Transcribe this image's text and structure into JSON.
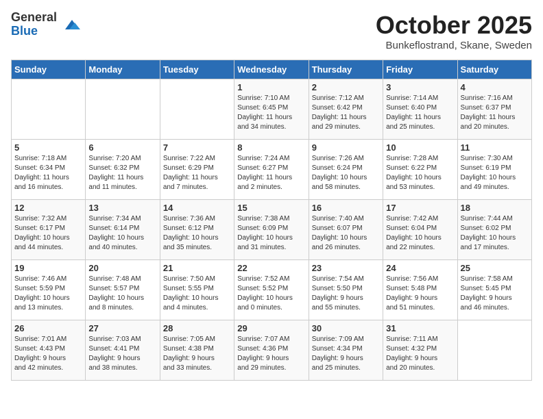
{
  "header": {
    "logo_general": "General",
    "logo_blue": "Blue",
    "month": "October 2025",
    "location": "Bunkeflostrand, Skane, Sweden"
  },
  "days_of_week": [
    "Sunday",
    "Monday",
    "Tuesday",
    "Wednesday",
    "Thursday",
    "Friday",
    "Saturday"
  ],
  "weeks": [
    [
      {
        "day": "",
        "info": ""
      },
      {
        "day": "",
        "info": ""
      },
      {
        "day": "",
        "info": ""
      },
      {
        "day": "1",
        "info": "Sunrise: 7:10 AM\nSunset: 6:45 PM\nDaylight: 11 hours\nand 34 minutes."
      },
      {
        "day": "2",
        "info": "Sunrise: 7:12 AM\nSunset: 6:42 PM\nDaylight: 11 hours\nand 29 minutes."
      },
      {
        "day": "3",
        "info": "Sunrise: 7:14 AM\nSunset: 6:40 PM\nDaylight: 11 hours\nand 25 minutes."
      },
      {
        "day": "4",
        "info": "Sunrise: 7:16 AM\nSunset: 6:37 PM\nDaylight: 11 hours\nand 20 minutes."
      }
    ],
    [
      {
        "day": "5",
        "info": "Sunrise: 7:18 AM\nSunset: 6:34 PM\nDaylight: 11 hours\nand 16 minutes."
      },
      {
        "day": "6",
        "info": "Sunrise: 7:20 AM\nSunset: 6:32 PM\nDaylight: 11 hours\nand 11 minutes."
      },
      {
        "day": "7",
        "info": "Sunrise: 7:22 AM\nSunset: 6:29 PM\nDaylight: 11 hours\nand 7 minutes."
      },
      {
        "day": "8",
        "info": "Sunrise: 7:24 AM\nSunset: 6:27 PM\nDaylight: 11 hours\nand 2 minutes."
      },
      {
        "day": "9",
        "info": "Sunrise: 7:26 AM\nSunset: 6:24 PM\nDaylight: 10 hours\nand 58 minutes."
      },
      {
        "day": "10",
        "info": "Sunrise: 7:28 AM\nSunset: 6:22 PM\nDaylight: 10 hours\nand 53 minutes."
      },
      {
        "day": "11",
        "info": "Sunrise: 7:30 AM\nSunset: 6:19 PM\nDaylight: 10 hours\nand 49 minutes."
      }
    ],
    [
      {
        "day": "12",
        "info": "Sunrise: 7:32 AM\nSunset: 6:17 PM\nDaylight: 10 hours\nand 44 minutes."
      },
      {
        "day": "13",
        "info": "Sunrise: 7:34 AM\nSunset: 6:14 PM\nDaylight: 10 hours\nand 40 minutes."
      },
      {
        "day": "14",
        "info": "Sunrise: 7:36 AM\nSunset: 6:12 PM\nDaylight: 10 hours\nand 35 minutes."
      },
      {
        "day": "15",
        "info": "Sunrise: 7:38 AM\nSunset: 6:09 PM\nDaylight: 10 hours\nand 31 minutes."
      },
      {
        "day": "16",
        "info": "Sunrise: 7:40 AM\nSunset: 6:07 PM\nDaylight: 10 hours\nand 26 minutes."
      },
      {
        "day": "17",
        "info": "Sunrise: 7:42 AM\nSunset: 6:04 PM\nDaylight: 10 hours\nand 22 minutes."
      },
      {
        "day": "18",
        "info": "Sunrise: 7:44 AM\nSunset: 6:02 PM\nDaylight: 10 hours\nand 17 minutes."
      }
    ],
    [
      {
        "day": "19",
        "info": "Sunrise: 7:46 AM\nSunset: 5:59 PM\nDaylight: 10 hours\nand 13 minutes."
      },
      {
        "day": "20",
        "info": "Sunrise: 7:48 AM\nSunset: 5:57 PM\nDaylight: 10 hours\nand 8 minutes."
      },
      {
        "day": "21",
        "info": "Sunrise: 7:50 AM\nSunset: 5:55 PM\nDaylight: 10 hours\nand 4 minutes."
      },
      {
        "day": "22",
        "info": "Sunrise: 7:52 AM\nSunset: 5:52 PM\nDaylight: 10 hours\nand 0 minutes."
      },
      {
        "day": "23",
        "info": "Sunrise: 7:54 AM\nSunset: 5:50 PM\nDaylight: 9 hours\nand 55 minutes."
      },
      {
        "day": "24",
        "info": "Sunrise: 7:56 AM\nSunset: 5:48 PM\nDaylight: 9 hours\nand 51 minutes."
      },
      {
        "day": "25",
        "info": "Sunrise: 7:58 AM\nSunset: 5:45 PM\nDaylight: 9 hours\nand 46 minutes."
      }
    ],
    [
      {
        "day": "26",
        "info": "Sunrise: 7:01 AM\nSunset: 4:43 PM\nDaylight: 9 hours\nand 42 minutes."
      },
      {
        "day": "27",
        "info": "Sunrise: 7:03 AM\nSunset: 4:41 PM\nDaylight: 9 hours\nand 38 minutes."
      },
      {
        "day": "28",
        "info": "Sunrise: 7:05 AM\nSunset: 4:38 PM\nDaylight: 9 hours\nand 33 minutes."
      },
      {
        "day": "29",
        "info": "Sunrise: 7:07 AM\nSunset: 4:36 PM\nDaylight: 9 hours\nand 29 minutes."
      },
      {
        "day": "30",
        "info": "Sunrise: 7:09 AM\nSunset: 4:34 PM\nDaylight: 9 hours\nand 25 minutes."
      },
      {
        "day": "31",
        "info": "Sunrise: 7:11 AM\nSunset: 4:32 PM\nDaylight: 9 hours\nand 20 minutes."
      },
      {
        "day": "",
        "info": ""
      }
    ]
  ]
}
